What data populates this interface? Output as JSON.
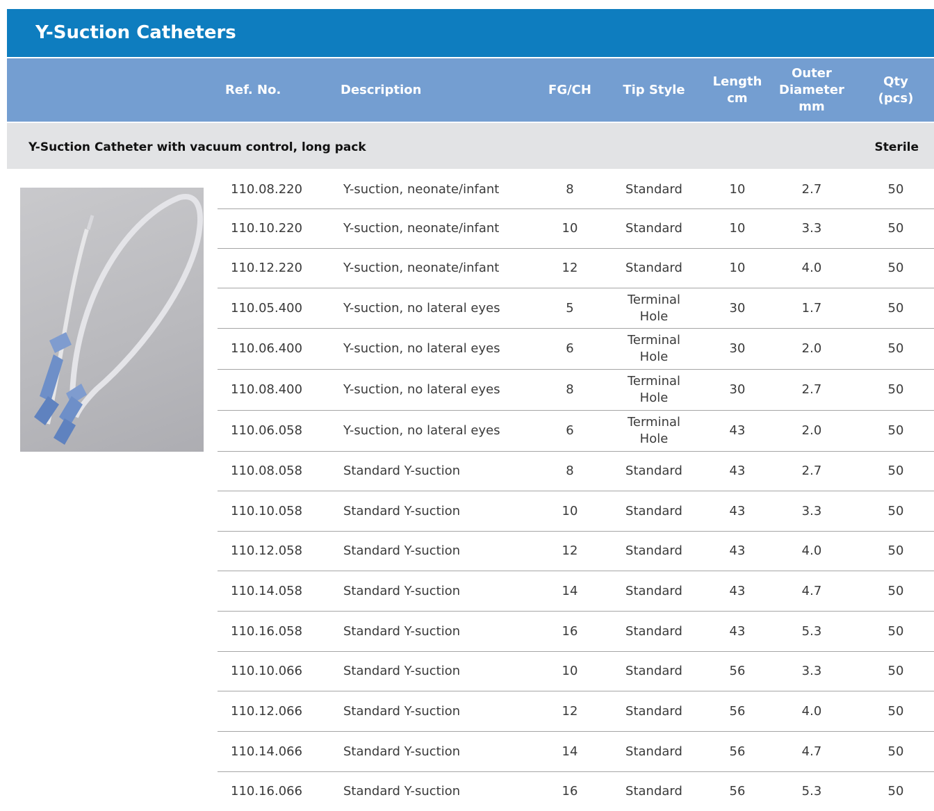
{
  "title": "Y-Suction Catheters",
  "columns": {
    "ref": "Ref. No.",
    "description": "Description",
    "fg": "FG/CH",
    "tip": "Tip Style",
    "length": "Length\ncm",
    "outer_diameter": "Outer\nDiameter\nmm",
    "qty": "Qty\n(pcs)"
  },
  "section": {
    "title": "Y-Suction Catheter with vacuum control, long pack",
    "badge": "Sterile"
  },
  "rows": [
    {
      "ref": "110.08.220",
      "description": "Y-suction, neonate/infant",
      "fg": "8",
      "tip": "Standard",
      "length": "10",
      "od": "2.7",
      "qty": "50"
    },
    {
      "ref": "110.10.220",
      "description": "Y-suction, neonate/infant",
      "fg": "10",
      "tip": "Standard",
      "length": "10",
      "od": "3.3",
      "qty": "50"
    },
    {
      "ref": "110.12.220",
      "description": "Y-suction, neonate/infant",
      "fg": "12",
      "tip": "Standard",
      "length": "10",
      "od": "4.0",
      "qty": "50"
    },
    {
      "ref": "110.05.400",
      "description": "Y-suction, no lateral eyes",
      "fg": "5",
      "tip": "Terminal\nHole",
      "length": "30",
      "od": "1.7",
      "qty": "50"
    },
    {
      "ref": "110.06.400",
      "description": "Y-suction, no lateral eyes",
      "fg": "6",
      "tip": "Terminal\nHole",
      "length": "30",
      "od": "2.0",
      "qty": "50"
    },
    {
      "ref": "110.08.400",
      "description": "Y-suction, no lateral eyes",
      "fg": "8",
      "tip": "Terminal\nHole",
      "length": "30",
      "od": "2.7",
      "qty": "50"
    },
    {
      "ref": "110.06.058",
      "description": "Y-suction, no lateral eyes",
      "fg": "6",
      "tip": "Terminal\nHole",
      "length": "43",
      "od": "2.0",
      "qty": "50"
    },
    {
      "ref": "110.08.058",
      "description": "Standard Y-suction",
      "fg": "8",
      "tip": "Standard",
      "length": "43",
      "od": "2.7",
      "qty": "50"
    },
    {
      "ref": "110.10.058",
      "description": "Standard Y-suction",
      "fg": "10",
      "tip": "Standard",
      "length": "43",
      "od": "3.3",
      "qty": "50"
    },
    {
      "ref": "110.12.058",
      "description": "Standard Y-suction",
      "fg": "12",
      "tip": "Standard",
      "length": "43",
      "od": "4.0",
      "qty": "50"
    },
    {
      "ref": "110.14.058",
      "description": "Standard Y-suction",
      "fg": "14",
      "tip": "Standard",
      "length": "43",
      "od": "4.7",
      "qty": "50"
    },
    {
      "ref": "110.16.058",
      "description": "Standard Y-suction",
      "fg": "16",
      "tip": "Standard",
      "length": "43",
      "od": "5.3",
      "qty": "50"
    },
    {
      "ref": "110.10.066",
      "description": "Standard Y-suction",
      "fg": "10",
      "tip": "Standard",
      "length": "56",
      "od": "3.3",
      "qty": "50"
    },
    {
      "ref": "110.12.066",
      "description": "Standard Y-suction",
      "fg": "12",
      "tip": "Standard",
      "length": "56",
      "od": "4.0",
      "qty": "50"
    },
    {
      "ref": "110.14.066",
      "description": "Standard Y-suction",
      "fg": "14",
      "tip": "Standard",
      "length": "56",
      "od": "4.7",
      "qty": "50"
    },
    {
      "ref": "110.16.066",
      "description": "Standard Y-suction",
      "fg": "16",
      "tip": "Standard",
      "length": "56",
      "od": "5.3",
      "qty": "50"
    }
  ]
}
